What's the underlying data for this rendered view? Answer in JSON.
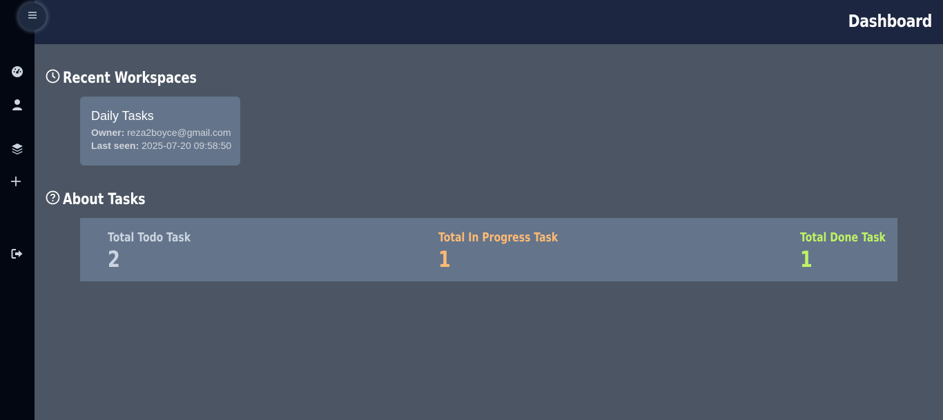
{
  "header": {
    "title": "Dashboard"
  },
  "sidebar": {
    "icons": [
      "menu-icon",
      "dashboard-icon",
      "user-icon",
      "layers-icon",
      "plus-icon",
      "logout-icon"
    ]
  },
  "recent": {
    "heading": "Recent Workspaces",
    "icon": "clock-icon",
    "workspaces": [
      {
        "name": "Daily Tasks",
        "owner_label": "Owner:",
        "owner": "reza2boyce@gmail.com",
        "last_seen_label": "Last seen:",
        "last_seen": "2025-07-20 09:58:50"
      }
    ]
  },
  "about": {
    "heading": "About Tasks",
    "icon": "question-circle-icon",
    "stats": [
      {
        "label": "Total Todo Task",
        "value": "2",
        "color": "#cbd5e1"
      },
      {
        "label": "Total In Progress Task",
        "value": "1",
        "color": "#fdba74"
      },
      {
        "label": "Total Done Task",
        "value": "1",
        "color": "#bef264"
      }
    ]
  },
  "colors": {
    "sidebar": "#030712",
    "topbar": "#1c2640",
    "background": "#4b5563",
    "card": "#64748b"
  }
}
